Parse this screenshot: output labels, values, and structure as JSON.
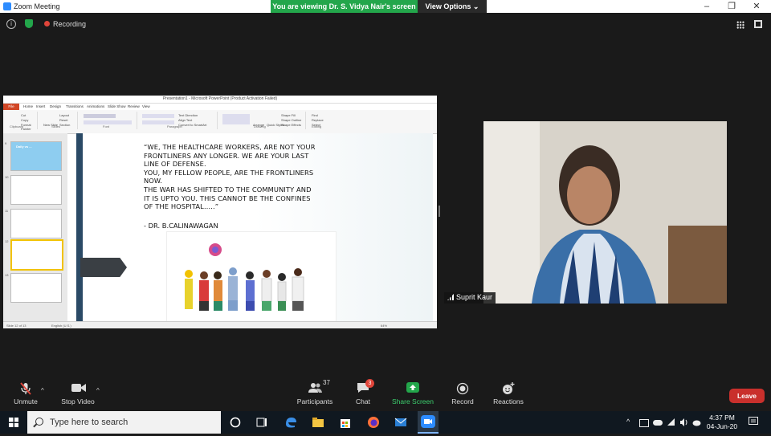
{
  "window": {
    "title": "Zoom Meeting",
    "minimize_glyph": "–",
    "maximize_glyph": "❐",
    "close_glyph": "✕"
  },
  "share_banner": {
    "text": "You are viewing Dr. S. Vidya Nair's screen",
    "options_label": "View Options",
    "options_caret": "⌄"
  },
  "topbar": {
    "info_glyph": "i",
    "recording_label": "Recording"
  },
  "shared_screen": {
    "window_title": "Presentation1 - Microsoft PowerPoint (Product Activation Failed)",
    "ribbon_tabs": [
      "File",
      "Home",
      "Insert",
      "Design",
      "Transitions",
      "Animations",
      "Slide Show",
      "Review",
      "View"
    ],
    "ribbon_groups": [
      "Clipboard",
      "Slides",
      "Font",
      "Paragraph",
      "Drawing",
      "Editing"
    ],
    "ribbon_commands": [
      "Cut",
      "Copy",
      "Format Painter",
      "New Slide",
      "Layout",
      "Reset",
      "Section",
      "Text Direction",
      "Align Text",
      "Convert to SmartArt",
      "Arrange",
      "Quick Styles",
      "Shape Fill",
      "Shape Outline",
      "Shape Effects",
      "Find",
      "Replace",
      "Select"
    ],
    "thumb_numbers": [
      "9",
      "10",
      "11",
      "12",
      "13"
    ],
    "thumb_title": "Daily vs ...",
    "slide_quote": "“WE, THE HEALTHCARE WORKERS, ARE NOT YOUR\nFRONTLINERS ANY LONGER. WE ARE YOUR LAST\nLINE OF DEFENSE.\nYOU, MY FELLOW PEOPLE, ARE THE FRONTLINERS\nNOW.\nTHE WAR HAS SHIFTED TO THE COMMUNITY AND\nIT IS UPTO YOU. THIS CANNOT BE THE CONFINES\nOF THE HOSPITAL…..”",
    "slide_attribution": "- DR. B.CALINAWAGAN",
    "status_left": "Slide 12 of 13",
    "status_right": "English (U.S.)",
    "zoom_level": "64%"
  },
  "participant": {
    "name": "Suprit Kaur"
  },
  "toolbar": {
    "unmute_label": "Unmute",
    "stop_video_label": "Stop Video",
    "participants_label": "Participants",
    "participants_count": "37",
    "chat_label": "Chat",
    "chat_badge": "3",
    "share_label": "Share Screen",
    "record_label": "Record",
    "reactions_label": "Reactions",
    "leave_label": "Leave",
    "caret": "^"
  },
  "taskbar": {
    "search_placeholder": "Type here to search",
    "time": "4:37 PM",
    "date": "04-Jun-20",
    "apps": [
      "cortana-icon",
      "task-view-icon",
      "edge-icon",
      "file-explorer-icon",
      "store-icon",
      "firefox-icon",
      "mail-icon",
      "zoom-icon"
    ]
  },
  "colors": {
    "accent_green": "#23a64b",
    "leave_red": "#c9302c",
    "zoom_blue": "#2d8cff",
    "slide_bar": "#2b4a66"
  }
}
